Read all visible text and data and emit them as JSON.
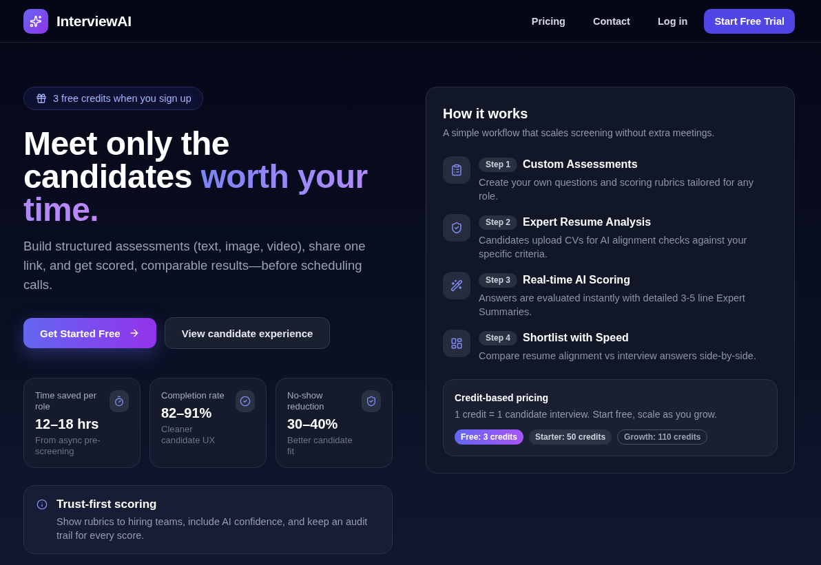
{
  "header": {
    "brand": "InterviewAI",
    "nav": [
      "Pricing",
      "Contact",
      "Log in"
    ],
    "cta": "Start Free Trial"
  },
  "hero": {
    "badge": "3 free credits when you sign up",
    "headline": "Meet only the candidates",
    "headline_highlight": "worth your time.",
    "lead": "Build structured assessments (text, image, video), share one link, and get scored, comparable results—before scheduling calls.",
    "buttons": [
      {
        "label": "Get Started Free",
        "kind": "primary"
      },
      {
        "label": "View candidate experience",
        "kind": "secondary"
      }
    ],
    "stats": [
      {
        "label": "Time saved per role",
        "value": "12–18 hrs",
        "note": "From async pre-screening"
      },
      {
        "label": "Completion rate",
        "value": "82–91%",
        "note": "Cleaner candidate UX"
      },
      {
        "label": "No-show reduction",
        "value": "30–40%",
        "note": "Better candidate fit"
      }
    ],
    "notice": {
      "title": "Trust-first scoring",
      "text": "Show rubrics to hiring teams, include AI confidence, and keep an audit trail for every score."
    }
  },
  "how_it_works": {
    "title": "How it works",
    "subtitle": "A simple workflow that scales screening without extra meetings.",
    "steps": [
      {
        "step": "Step 1",
        "title": "Custom Assessments",
        "text": "Create your own questions and scoring rubrics tailored for any role."
      },
      {
        "step": "Step 2",
        "title": "Expert Resume Analysis",
        "text": "Candidates upload CVs for AI alignment checks against your specific criteria."
      },
      {
        "step": "Step 3",
        "title": "Real-time AI Scoring",
        "text": "Answers are evaluated instantly with detailed 3-5 line Expert Summaries."
      },
      {
        "step": "Step 4",
        "title": "Shortlist with Speed",
        "text": "Compare resume alignment vs interview answers side-by-side."
      }
    ],
    "pricing": {
      "title": "Credit-based pricing",
      "text": "1 credit = 1 candidate interview. Start free, scale as you grow.",
      "plans": [
        {
          "label": "Free: 3 credits",
          "kind": "highlight"
        },
        {
          "label": "Starter: 50 credits",
          "kind": "filled"
        },
        {
          "label": "Growth: 110 credits",
          "kind": "outline"
        }
      ]
    }
  }
}
